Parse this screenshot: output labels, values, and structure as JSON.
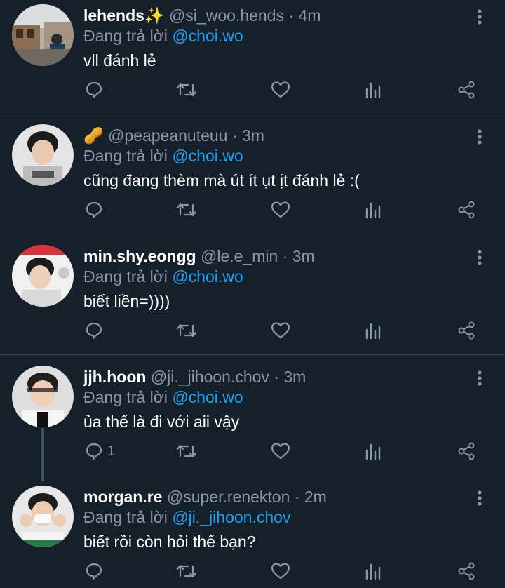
{
  "reply_prefix": "Đang trả lời",
  "tweets": [
    {
      "name": "lehends✨",
      "handle": "@si_woo.hends",
      "time": "4m",
      "reply_to": "@choi.wo",
      "text": "vll đánh lẻ",
      "reply_count": ""
    },
    {
      "name": "🥜",
      "handle": "@peapeanuteuu",
      "time": "3m",
      "reply_to": "@choi.wo",
      "text": "cũng đang thèm mà út ít ụt ịt đánh lẻ :(",
      "reply_count": ""
    },
    {
      "name": "min.shy.eongg",
      "handle": "@le.e_min",
      "time": "3m",
      "reply_to": "@choi.wo",
      "text": "biết liền=))))",
      "reply_count": ""
    },
    {
      "name": "jjh.hoon",
      "handle": "@ji._jihoon.chov",
      "time": "3m",
      "reply_to": "@choi.wo",
      "text": "ủa thế là đi với aii vậy",
      "reply_count": "1"
    },
    {
      "name": "morgan.re",
      "handle": "@super.renekton",
      "time": "2m",
      "reply_to": "@ji._jihoon.chov",
      "text": "biết rồi còn hỏi thế bạn?",
      "reply_count": ""
    }
  ],
  "icons": {
    "reply": "reply-icon",
    "retweet": "retweet-icon",
    "like": "heart-icon",
    "stats": "stats-icon",
    "share": "share-icon",
    "more": "more-vertical-icon"
  },
  "colors": {
    "background": "#15202b",
    "mention": "#1da1f2",
    "muted": "#8899a6",
    "divider": "#38444d"
  }
}
